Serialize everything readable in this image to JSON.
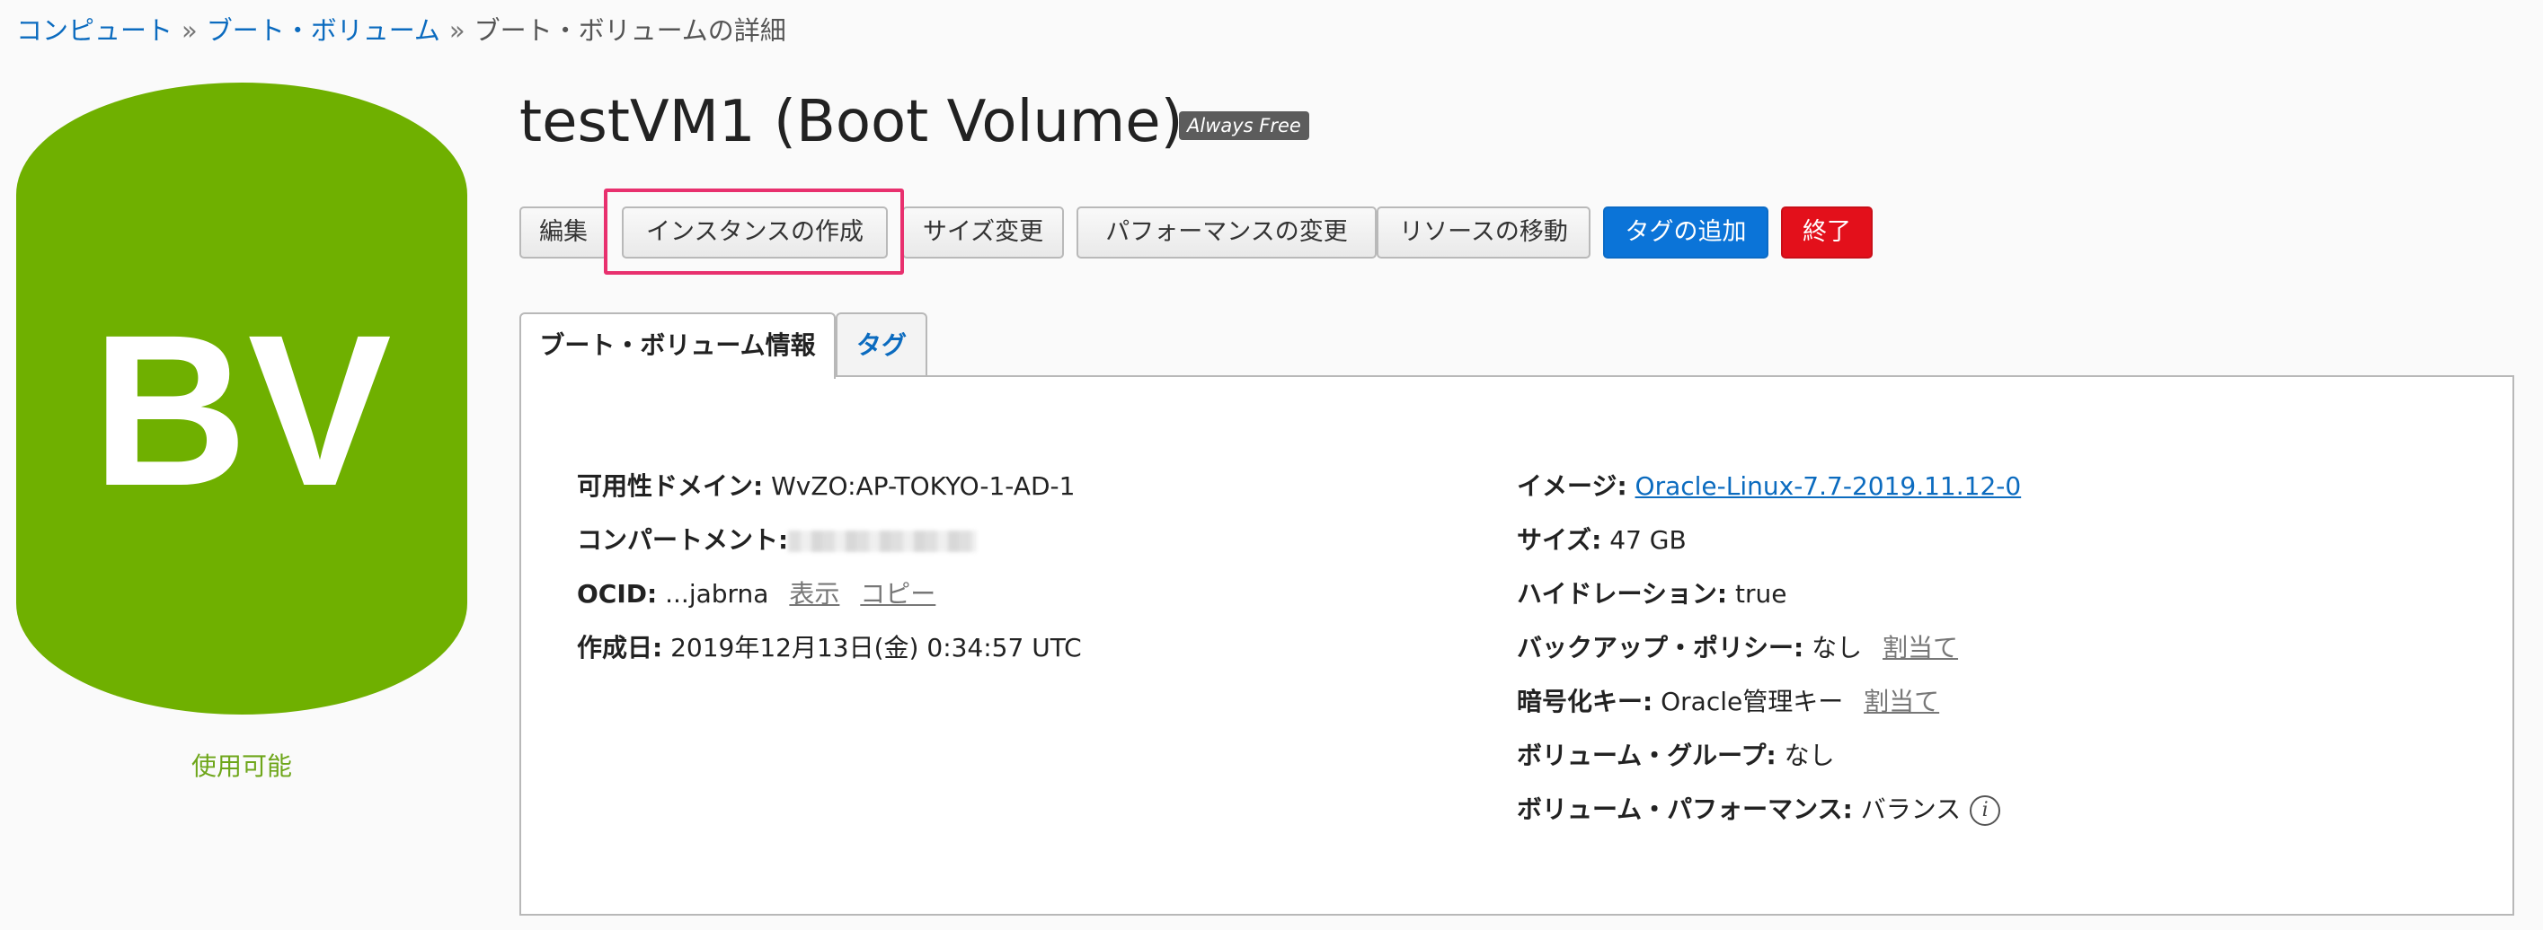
{
  "breadcrumb": {
    "items": [
      "コンピュート",
      "ブート・ボリューム",
      "ブート・ボリュームの詳細"
    ],
    "separator": "»"
  },
  "icon": {
    "text": "BV",
    "color": "#6fb000",
    "status": "使用可能"
  },
  "header": {
    "title": "testVM1 (Boot Volume)",
    "badge": "Always Free"
  },
  "toolbar": {
    "buttons": [
      "編集",
      "インスタンスの作成",
      "サイズ変更",
      "パフォーマンスの変更",
      "リソースの移動",
      "タグの追加",
      "終了"
    ]
  },
  "tabs": [
    "ブート・ボリューム情報",
    "タグ"
  ],
  "details": {
    "left": {
      "availability_domain_label": "可用性ドメイン:",
      "availability_domain_value": "WvZO:AP-TOKYO-1-AD-1",
      "compartment_label": "コンパートメント:",
      "ocid_label": "OCID:",
      "ocid_value": "...jabrna",
      "ocid_show": "表示",
      "ocid_copy": "コピー",
      "created_label": "作成日:",
      "created_value": "2019年12月13日(金) 0:34:57 UTC"
    },
    "right": {
      "image_label": "イメージ:",
      "image_value": "Oracle-Linux-7.7-2019.11.12-0",
      "size_label": "サイズ:",
      "size_value": "47 GB",
      "hydration_label": "ハイドレーション:",
      "hydration_value": "true",
      "backup_label": "バックアップ・ポリシー:",
      "backup_value": "なし",
      "backup_assign": "割当て",
      "encryption_label": "暗号化キー:",
      "encryption_value": "Oracle管理キー",
      "encryption_assign": "割当て",
      "group_label": "ボリューム・グループ:",
      "group_value": "なし",
      "performance_label": "ボリューム・パフォーマンス:",
      "performance_value": "バランス"
    }
  },
  "colors": {
    "link": "#0b6bbf",
    "primary_button": "#0b74d8",
    "danger_button": "#e3101b",
    "highlight": "#e8306e",
    "status": "#6ea61a"
  }
}
